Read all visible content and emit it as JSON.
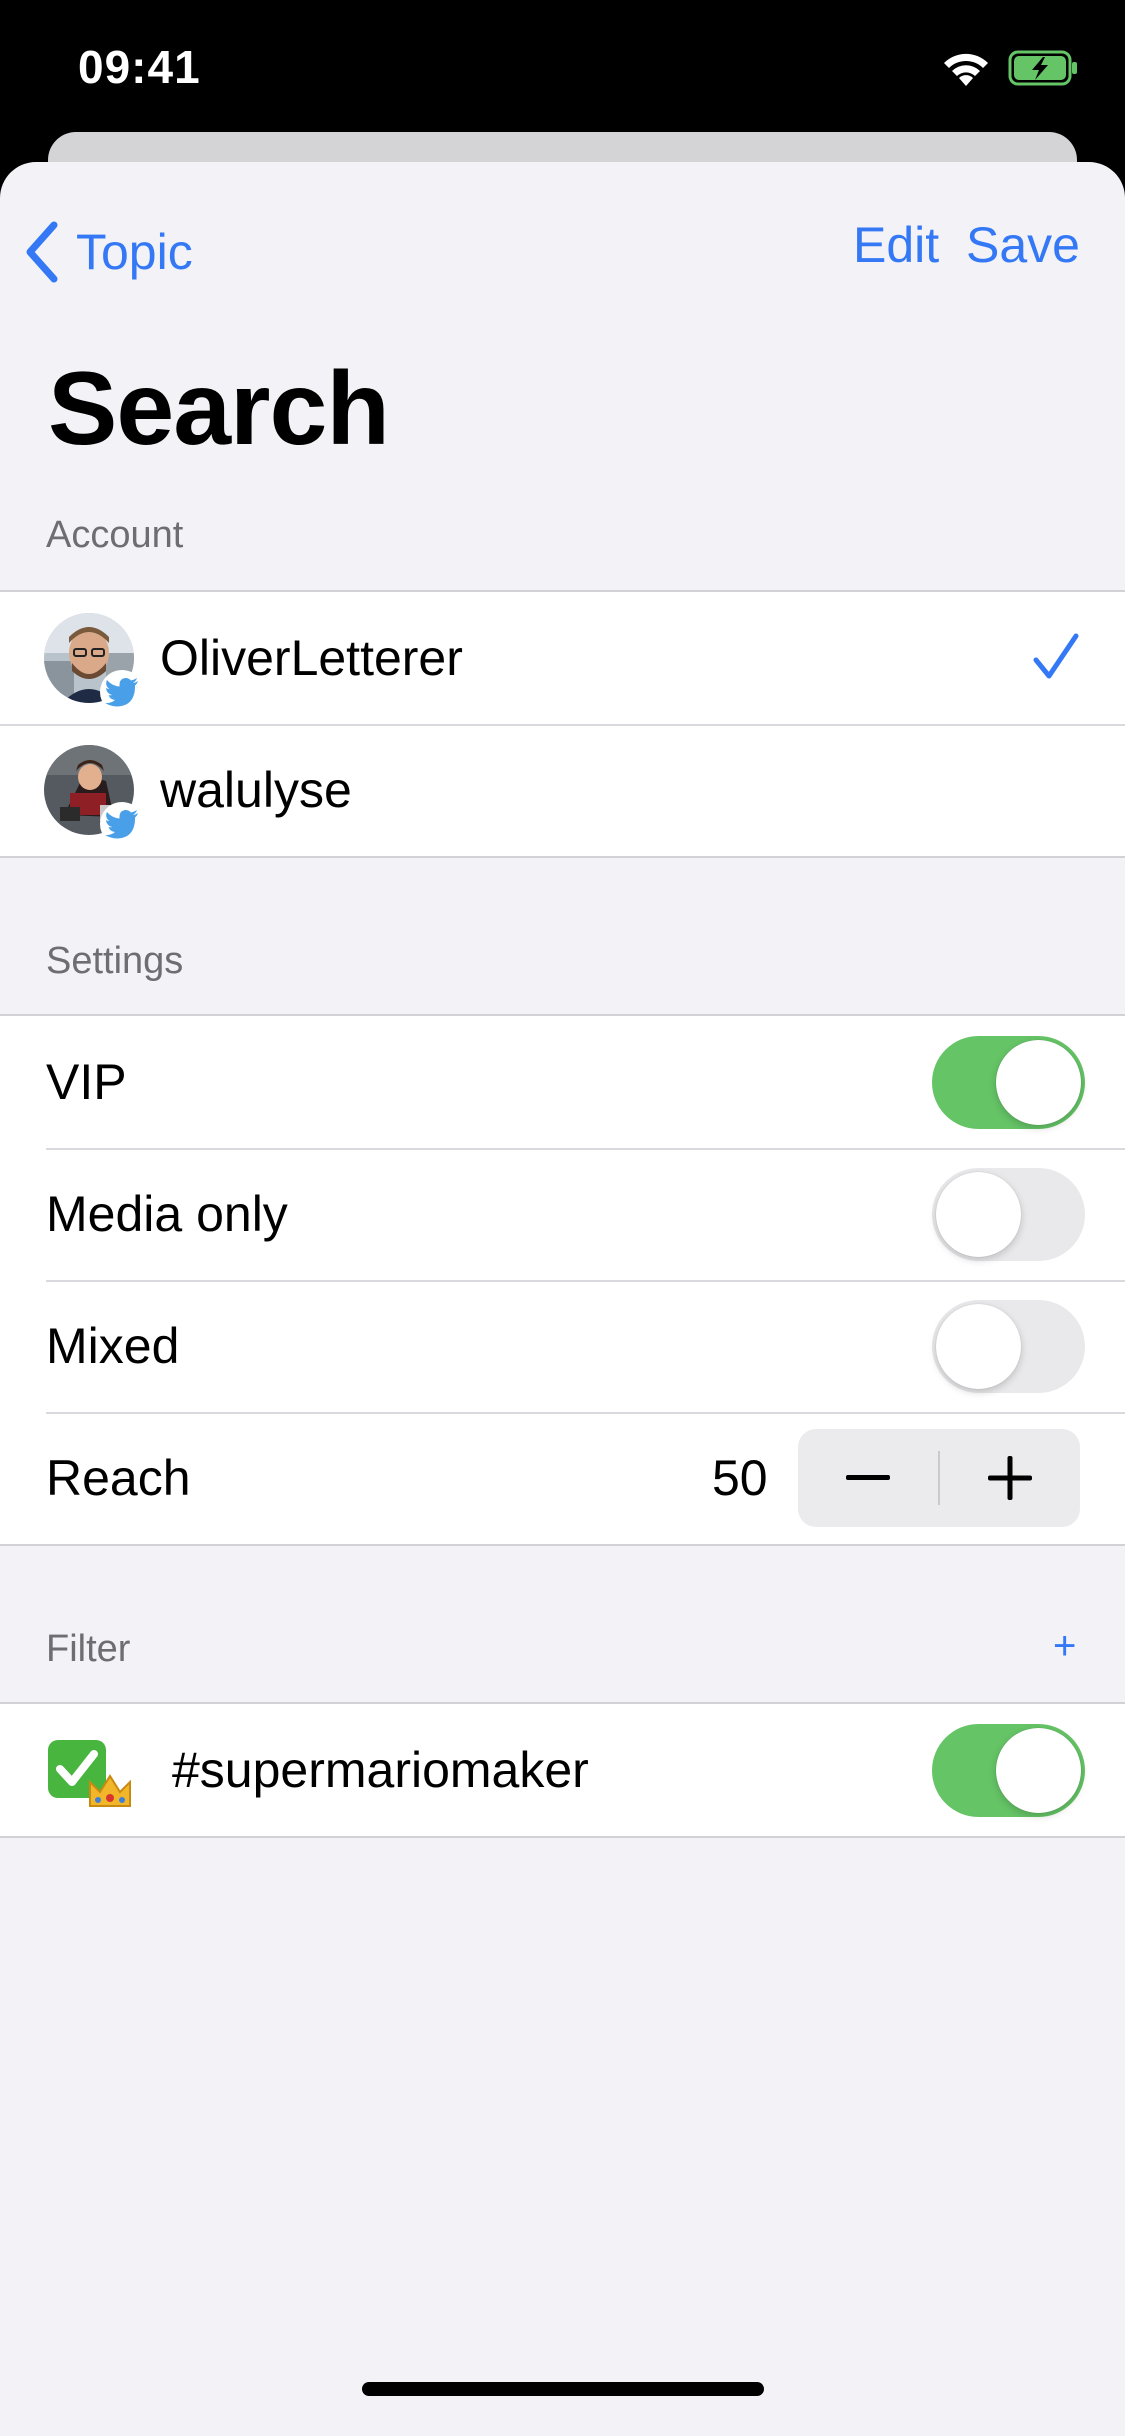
{
  "status": {
    "time": "09:41"
  },
  "nav": {
    "back_label": "Topic",
    "edit_label": "Edit",
    "save_label": "Save"
  },
  "title": "Search",
  "account": {
    "header": "Account",
    "items": [
      {
        "name": "OliverLetterer",
        "selected": true
      },
      {
        "name": "walulyse",
        "selected": false
      }
    ]
  },
  "settings": {
    "header": "Settings",
    "items": [
      {
        "label": "VIP",
        "on": true
      },
      {
        "label": "Media only",
        "on": false
      },
      {
        "label": "Mixed",
        "on": false
      }
    ],
    "reach": {
      "label": "Reach",
      "value": "50"
    }
  },
  "filter": {
    "header": "Filter",
    "add_label": "+",
    "items": [
      {
        "text": "#supermariomaker",
        "on": true
      }
    ]
  },
  "colors": {
    "accent": "#3478f6",
    "toggle_on": "#65c466",
    "background": "#f2f2f7"
  }
}
